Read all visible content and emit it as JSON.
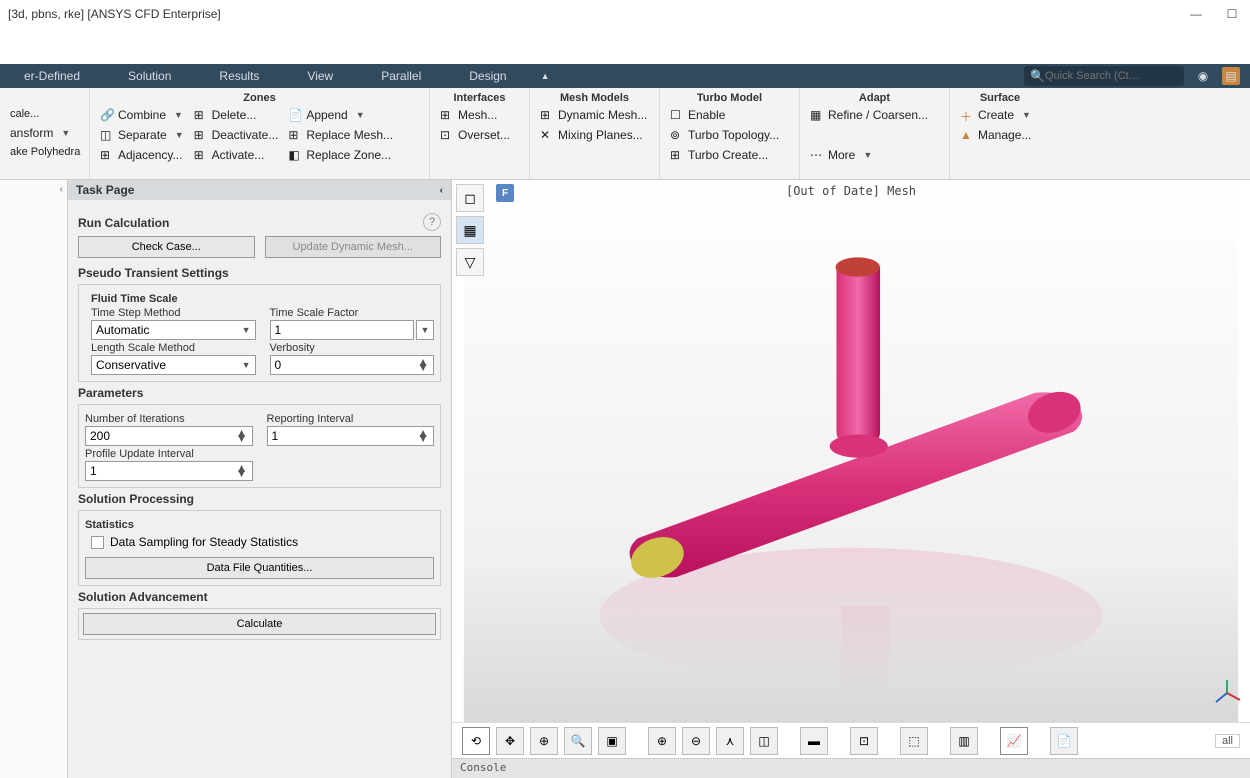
{
  "title": "[3d, pbns, rke] [ANSYS CFD Enterprise]",
  "menu": {
    "items": [
      "er-Defined",
      "Solution",
      "Results",
      "View",
      "Parallel",
      "Design"
    ],
    "search_placeholder": "Quick Search (Ct…"
  },
  "ribbon": {
    "groups": [
      {
        "header": "",
        "cols": [
          [
            {
              "label": "cale...",
              "icon": ""
            },
            {
              "label": "ansform",
              "icon": "",
              "drop": true
            },
            {
              "label": "ake Polyhedra",
              "icon": ""
            }
          ]
        ]
      },
      {
        "header": "Zones",
        "cols": [
          [
            {
              "label": "Combine",
              "icon": "🔗",
              "drop": true
            },
            {
              "label": "Separate",
              "icon": "◫",
              "drop": true
            },
            {
              "label": "Adjacency...",
              "icon": "⊞"
            }
          ],
          [
            {
              "label": "Delete...",
              "icon": "⊞"
            },
            {
              "label": "Deactivate...",
              "icon": "⊞"
            },
            {
              "label": "Activate...",
              "icon": "⊞"
            }
          ],
          [
            {
              "label": "Append",
              "icon": "📄",
              "drop": true
            },
            {
              "label": "Replace Mesh...",
              "icon": "⊞"
            },
            {
              "label": "Replace Zone...",
              "icon": "◧"
            }
          ]
        ]
      },
      {
        "header": "Interfaces",
        "cols": [
          [
            {
              "label": "Mesh...",
              "icon": "⊞"
            },
            {
              "label": "Overset...",
              "icon": "⊡"
            }
          ]
        ]
      },
      {
        "header": "Mesh Models",
        "cols": [
          [
            {
              "label": "Dynamic Mesh...",
              "icon": "⊞"
            },
            {
              "label": "Mixing Planes...",
              "icon": "✕"
            }
          ]
        ]
      },
      {
        "header": "Turbo Model",
        "cols": [
          [
            {
              "label": "Enable",
              "icon": "☐"
            },
            {
              "label": "Turbo Topology...",
              "icon": "⊚"
            },
            {
              "label": "Turbo Create...",
              "icon": "⊞"
            }
          ]
        ]
      },
      {
        "header": "Adapt",
        "cols": [
          [
            {
              "label": "Refine / Coarsen...",
              "icon": "▦"
            },
            {
              "label": "More",
              "icon": "⋯",
              "drop": true
            }
          ]
        ]
      },
      {
        "header": "Surface",
        "cols": [
          [
            {
              "label": "Create",
              "icon": "＋",
              "drop": true
            },
            {
              "label": "Manage...",
              "icon": "▲"
            }
          ]
        ]
      }
    ]
  },
  "task_page": {
    "header": "Task Page",
    "title": "Run Calculation",
    "check_case": "Check Case...",
    "update_dynamic": "Update Dynamic Mesh...",
    "pseudo_transient": "Pseudo Transient Settings",
    "fluid_time_scale": "Fluid Time Scale",
    "time_step_method_label": "Time Step Method",
    "time_step_method_value": "Automatic",
    "time_scale_factor_label": "Time Scale Factor",
    "time_scale_factor_value": "1",
    "length_scale_label": "Length Scale Method",
    "length_scale_value": "Conservative",
    "verbosity_label": "Verbosity",
    "verbosity_value": "0",
    "parameters": "Parameters",
    "num_iterations_label": "Number of Iterations",
    "num_iterations_value": "200",
    "reporting_interval_label": "Reporting Interval",
    "reporting_interval_value": "1",
    "profile_update_label": "Profile Update Interval",
    "profile_update_value": "1",
    "solution_processing": "Solution Processing",
    "statistics": "Statistics",
    "data_sampling": "Data Sampling for Steady Statistics",
    "data_file_quantities": "Data File Quantities...",
    "solution_advancement": "Solution Advancement",
    "calculate": "Calculate"
  },
  "viewport": {
    "header": "[Out of Date] Mesh",
    "tab": "F",
    "all": "all"
  },
  "console": "Console"
}
